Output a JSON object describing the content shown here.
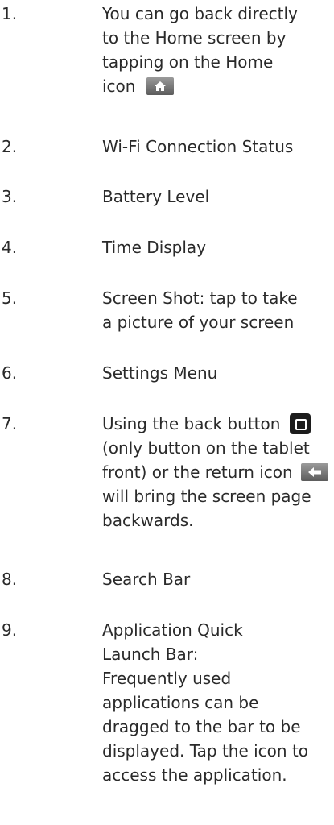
{
  "items": [
    {
      "number": "1.",
      "lines": [
        "You can go back directly",
        "to the Home screen by",
        "tapping on the Home",
        "icon"
      ],
      "icon": "home-icon"
    },
    {
      "number": "2.",
      "lines": [
        "Wi-Fi Connection Status"
      ]
    },
    {
      "number": "3.",
      "lines": [
        "Battery Level"
      ]
    },
    {
      "number": "4.",
      "lines": [
        "Time Display"
      ]
    },
    {
      "number": "5.",
      "lines": [
        "Screen Shot: tap to take",
        "a picture of your screen"
      ]
    },
    {
      "number": "6.",
      "lines": [
        "Settings Menu"
      ]
    },
    {
      "number": "7.",
      "lines": [
        "Using the back button",
        "(only button on the tablet",
        "front) or the return icon",
        "will bring the screen page",
        "backwards."
      ],
      "icons": [
        "back-button-icon",
        "return-icon"
      ]
    },
    {
      "number": "8.",
      "lines": [
        "Search Bar"
      ]
    },
    {
      "number": "9.",
      "lines": [
        "Application Quick",
        "Launch Bar:",
        "Frequently used",
        "applications can be",
        "dragged to the bar to be",
        "displayed. Tap the icon to",
        "access the application."
      ]
    }
  ]
}
